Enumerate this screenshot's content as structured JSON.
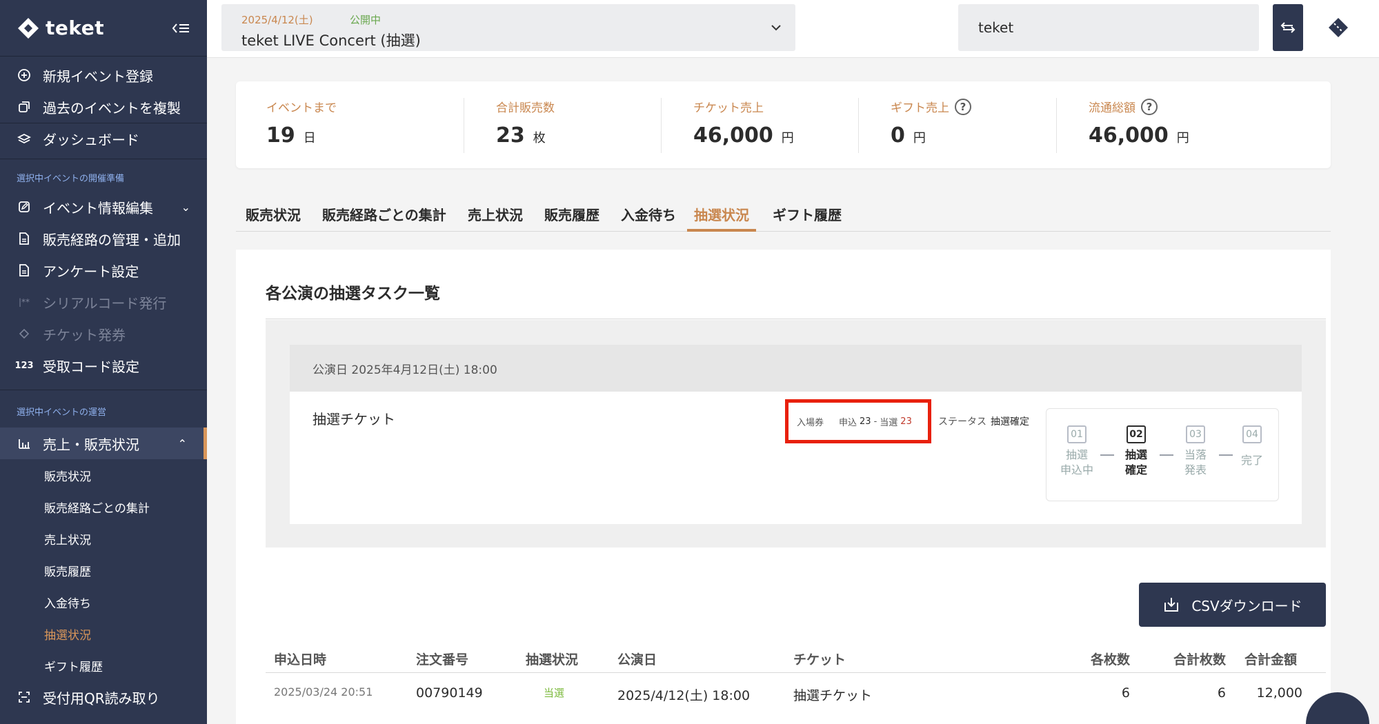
{
  "sidebar": {
    "logo": "teket",
    "top_items": [
      {
        "label": "新規イベント登録",
        "icon": "plus-circle-icon"
      },
      {
        "label": "過去のイベントを複製",
        "icon": "copy-icon"
      },
      {
        "label": "ダッシュボード",
        "icon": "layers-icon"
      }
    ],
    "section_prep": "選択中イベントの開催準備",
    "prep_items": [
      {
        "label": "イベント情報編集",
        "icon": "edit-icon"
      },
      {
        "label": "販売経路の管理・追加",
        "icon": "document-icon"
      },
      {
        "label": "アンケート設定",
        "icon": "document-icon"
      },
      {
        "label": "シリアルコード発行",
        "icon": "serial-icon"
      },
      {
        "label": "チケット発券",
        "icon": "ticket-icon"
      },
      {
        "label": "受取コード設定",
        "icon": "123"
      }
    ],
    "section_ops": "選択中イベントの運営",
    "sales_label": "売上・販売状況",
    "sub_items": [
      "販売状況",
      "販売経路ごとの集計",
      "売上状況",
      "販売履歴",
      "入金待ち",
      "抽選状況",
      "ギフト履歴"
    ],
    "qr_label": "受付用QR読み取り"
  },
  "header": {
    "event_date": "2025/4/12(土)",
    "event_status": "公開中",
    "event_title": "teket LIVE Concert (抽選)",
    "org": "teket"
  },
  "stats": {
    "days": {
      "label": "イベントまで",
      "value": "19",
      "unit": "日"
    },
    "sold": {
      "label": "合計販売数",
      "value": "23",
      "unit": "枚"
    },
    "ticket_sales": {
      "label": "チケット売上",
      "value": "46,000",
      "unit": "円"
    },
    "gift_sales": {
      "label": "ギフト売上",
      "value": "0",
      "unit": "円"
    },
    "total": {
      "label": "流通総額",
      "value": "46,000",
      "unit": "円"
    }
  },
  "tabs": [
    "販売状況",
    "販売経路ごとの集計",
    "売上状況",
    "販売履歴",
    "入金待ち",
    "抽選状況",
    "ギフト履歴"
  ],
  "lottery": {
    "title": "各公演の抽選タスク一覧",
    "performance": "公演日 2025年4月12日(土) 18:00",
    "ticket_name": "抽選チケット",
    "ticket_type": "入場券",
    "apply_label": "申込",
    "apply_count": "23",
    "win_label": "当選",
    "win_count": "23",
    "status_label": "ステータス",
    "status_value": "抽選確定",
    "steps": [
      {
        "num": "01",
        "label_1": "抽選",
        "label_2": "申込中"
      },
      {
        "num": "02",
        "label_1": "抽選",
        "label_2": "確定"
      },
      {
        "num": "03",
        "label_1": "当落",
        "label_2": "発表"
      },
      {
        "num": "04",
        "label_1": "完了",
        "label_2": ""
      }
    ]
  },
  "csv_button": "CSVダウンロード",
  "table": {
    "headers": [
      "申込日時",
      "注文番号",
      "抽選状況",
      "公演日",
      "チケット",
      "各枚数",
      "合計枚数",
      "合計金額"
    ],
    "rows": [
      {
        "date": "2025/03/24 20:51",
        "order": "00790149",
        "status": "当選",
        "perf": "2025/4/12(土) 18:00",
        "ticket": "抽選チケット",
        "each": "6",
        "qty": "6",
        "amount": "12,000"
      }
    ]
  }
}
